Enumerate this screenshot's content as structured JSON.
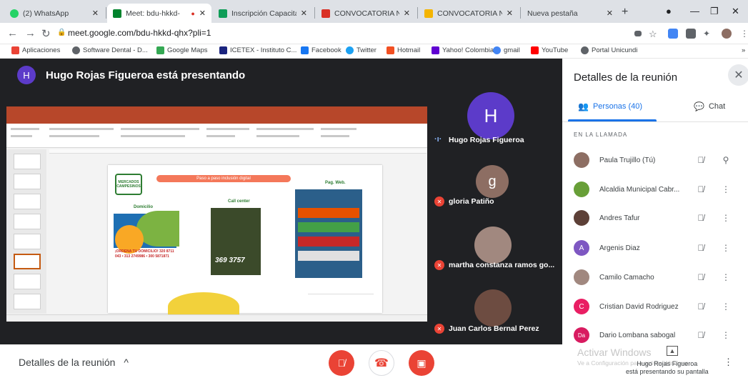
{
  "browser": {
    "tabs": [
      {
        "label": "(2) WhatsApp",
        "color": "#25d366"
      },
      {
        "label": "Meet: bdu-hkkd-",
        "color": "#00832d",
        "active": true
      },
      {
        "label": "Inscripción Capacitac",
        "color": "#0f9d58"
      },
      {
        "label": "CONVOCATORIA No.",
        "color": "#d93025"
      },
      {
        "label": "CONVOCATORIA No.",
        "color": "#f4b400"
      },
      {
        "label": "Nueva pestaña",
        "color": "#ffffff"
      }
    ],
    "tab_close": "✕",
    "new_tab": "+",
    "url": "meet.google.com/bdu-hkkd-qhx?pli=1",
    "bookmarks": [
      {
        "label": "Aplicaciones",
        "color": "#ea4335"
      },
      {
        "label": "Software Dental - D...",
        "color": "#5f6368"
      },
      {
        "label": "Google Maps",
        "color": "#34a853"
      },
      {
        "label": "ICETEX - Instituto C...",
        "color": "#1a237e"
      },
      {
        "label": "Facebook",
        "color": "#1877f2"
      },
      {
        "label": "Twitter",
        "color": "#1da1f2"
      },
      {
        "label": "Hotmail",
        "color": "#f25022"
      },
      {
        "label": "Yahoo! Colombia",
        "color": "#6001d2"
      },
      {
        "label": "gmail",
        "color": "#4285f4"
      },
      {
        "label": "YouTube",
        "color": "#ff0000"
      },
      {
        "label": "Portal Unicundi",
        "color": "#5f6368"
      }
    ]
  },
  "meet": {
    "presenter_initial": "H",
    "presenter_text": "Hugo Rojas Figueroa está presentando",
    "slide": {
      "banner": "Paso a paso inclusión digital",
      "logo": "MERCADOS CAMPESINOS",
      "sec_domicilio": "Domicilio",
      "sec_call": "Call center",
      "sec_web": "Pag. Web.",
      "domicilio_text": "¡ORDENA TU DOMICILIO! 320 8711 043 • 313 2749986 • 300 5871871",
      "phone": "369 3757"
    },
    "tiles": [
      {
        "name": "Hugo Rojas Figueroa",
        "initial": "H",
        "color": "#5c3bc9",
        "speaking": true
      },
      {
        "name": "gloria Patiño",
        "initial": "g",
        "color": "#8d6e63",
        "muted": true
      },
      {
        "name": "martha constanza ramos go...",
        "initial": "",
        "color": "#a1887f",
        "muted": true
      },
      {
        "name": "Juan Carlos Bernal Perez",
        "initial": "",
        "color": "#6d4c41",
        "muted": true
      }
    ],
    "details_label": "Detalles de la reunión",
    "activate_title": "Activar Windows",
    "activate_sub": "Ve a Configuración para activar Windows.",
    "present_note": "Hugo Rojas Figueroa\nestá presentando su pantalla"
  },
  "panel": {
    "title": "Detalles de la reunión",
    "tab_people": "Personas (40)",
    "tab_chat": "Chat",
    "in_call": "EN LA LLAMADA",
    "people": [
      {
        "name": "Paula Trujillo (Tú)",
        "initial": "",
        "color": "#8d6e63",
        "pin": true
      },
      {
        "name": "Alcaldia Municipal Cabr...",
        "initial": "",
        "color": "#689f38"
      },
      {
        "name": "Andres Tafur",
        "initial": "",
        "color": "#5d4037"
      },
      {
        "name": "Argenis Diaz",
        "initial": "A",
        "color": "#7e57c2"
      },
      {
        "name": "Camilo Camacho",
        "initial": "",
        "color": "#a1887f"
      },
      {
        "name": "Cristian David Rodriguez",
        "initial": "C",
        "color": "#e91e63"
      },
      {
        "name": "Dario Lombana sabogal",
        "initial": "Da",
        "color": "#d81b60"
      }
    ]
  }
}
